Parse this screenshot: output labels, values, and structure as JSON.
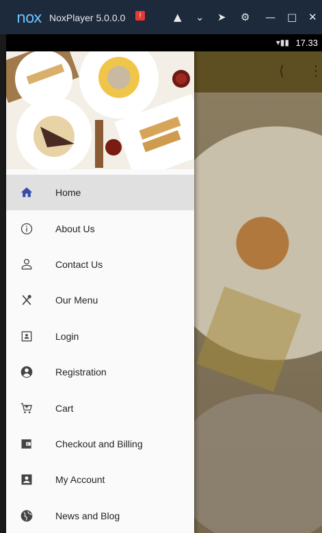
{
  "window": {
    "logo": "nox",
    "title": "NoxPlayer 5.0.0.0",
    "alert_badge": "!",
    "controls": [
      "shirt-icon",
      "chevron-down-icon",
      "pin-icon",
      "gear-icon",
      "minimize-icon",
      "maximize-icon",
      "close-icon"
    ]
  },
  "statusbar": {
    "time": "17.33",
    "signal": "wifi+cellular"
  },
  "appbar": {
    "share_icon": "share-icon",
    "more_icon": "more-vert-icon"
  },
  "drawer": {
    "items": [
      {
        "label": "Home",
        "icon": "home-icon",
        "active": true
      },
      {
        "label": "About Us",
        "icon": "info-icon",
        "active": false
      },
      {
        "label": "Contact Us",
        "icon": "person-outline-icon",
        "active": false
      },
      {
        "label": "Our Menu",
        "icon": "utensils-icon",
        "active": false
      },
      {
        "label": "Login",
        "icon": "contact-card-icon",
        "active": false
      },
      {
        "label": "Registration",
        "icon": "account-circle-icon",
        "active": false
      },
      {
        "label": "Cart",
        "icon": "cart-icon",
        "active": false
      },
      {
        "label": "Checkout and Billing",
        "icon": "wallet-icon",
        "active": false
      },
      {
        "label": "My Account",
        "icon": "account-box-icon",
        "active": false
      },
      {
        "label": "News and Blog",
        "icon": "globe-icon",
        "active": false
      }
    ]
  },
  "colors": {
    "active_icon": "#3949ab",
    "active_bg": "#e0e0e0",
    "titlebar": "#1d2a3b"
  }
}
